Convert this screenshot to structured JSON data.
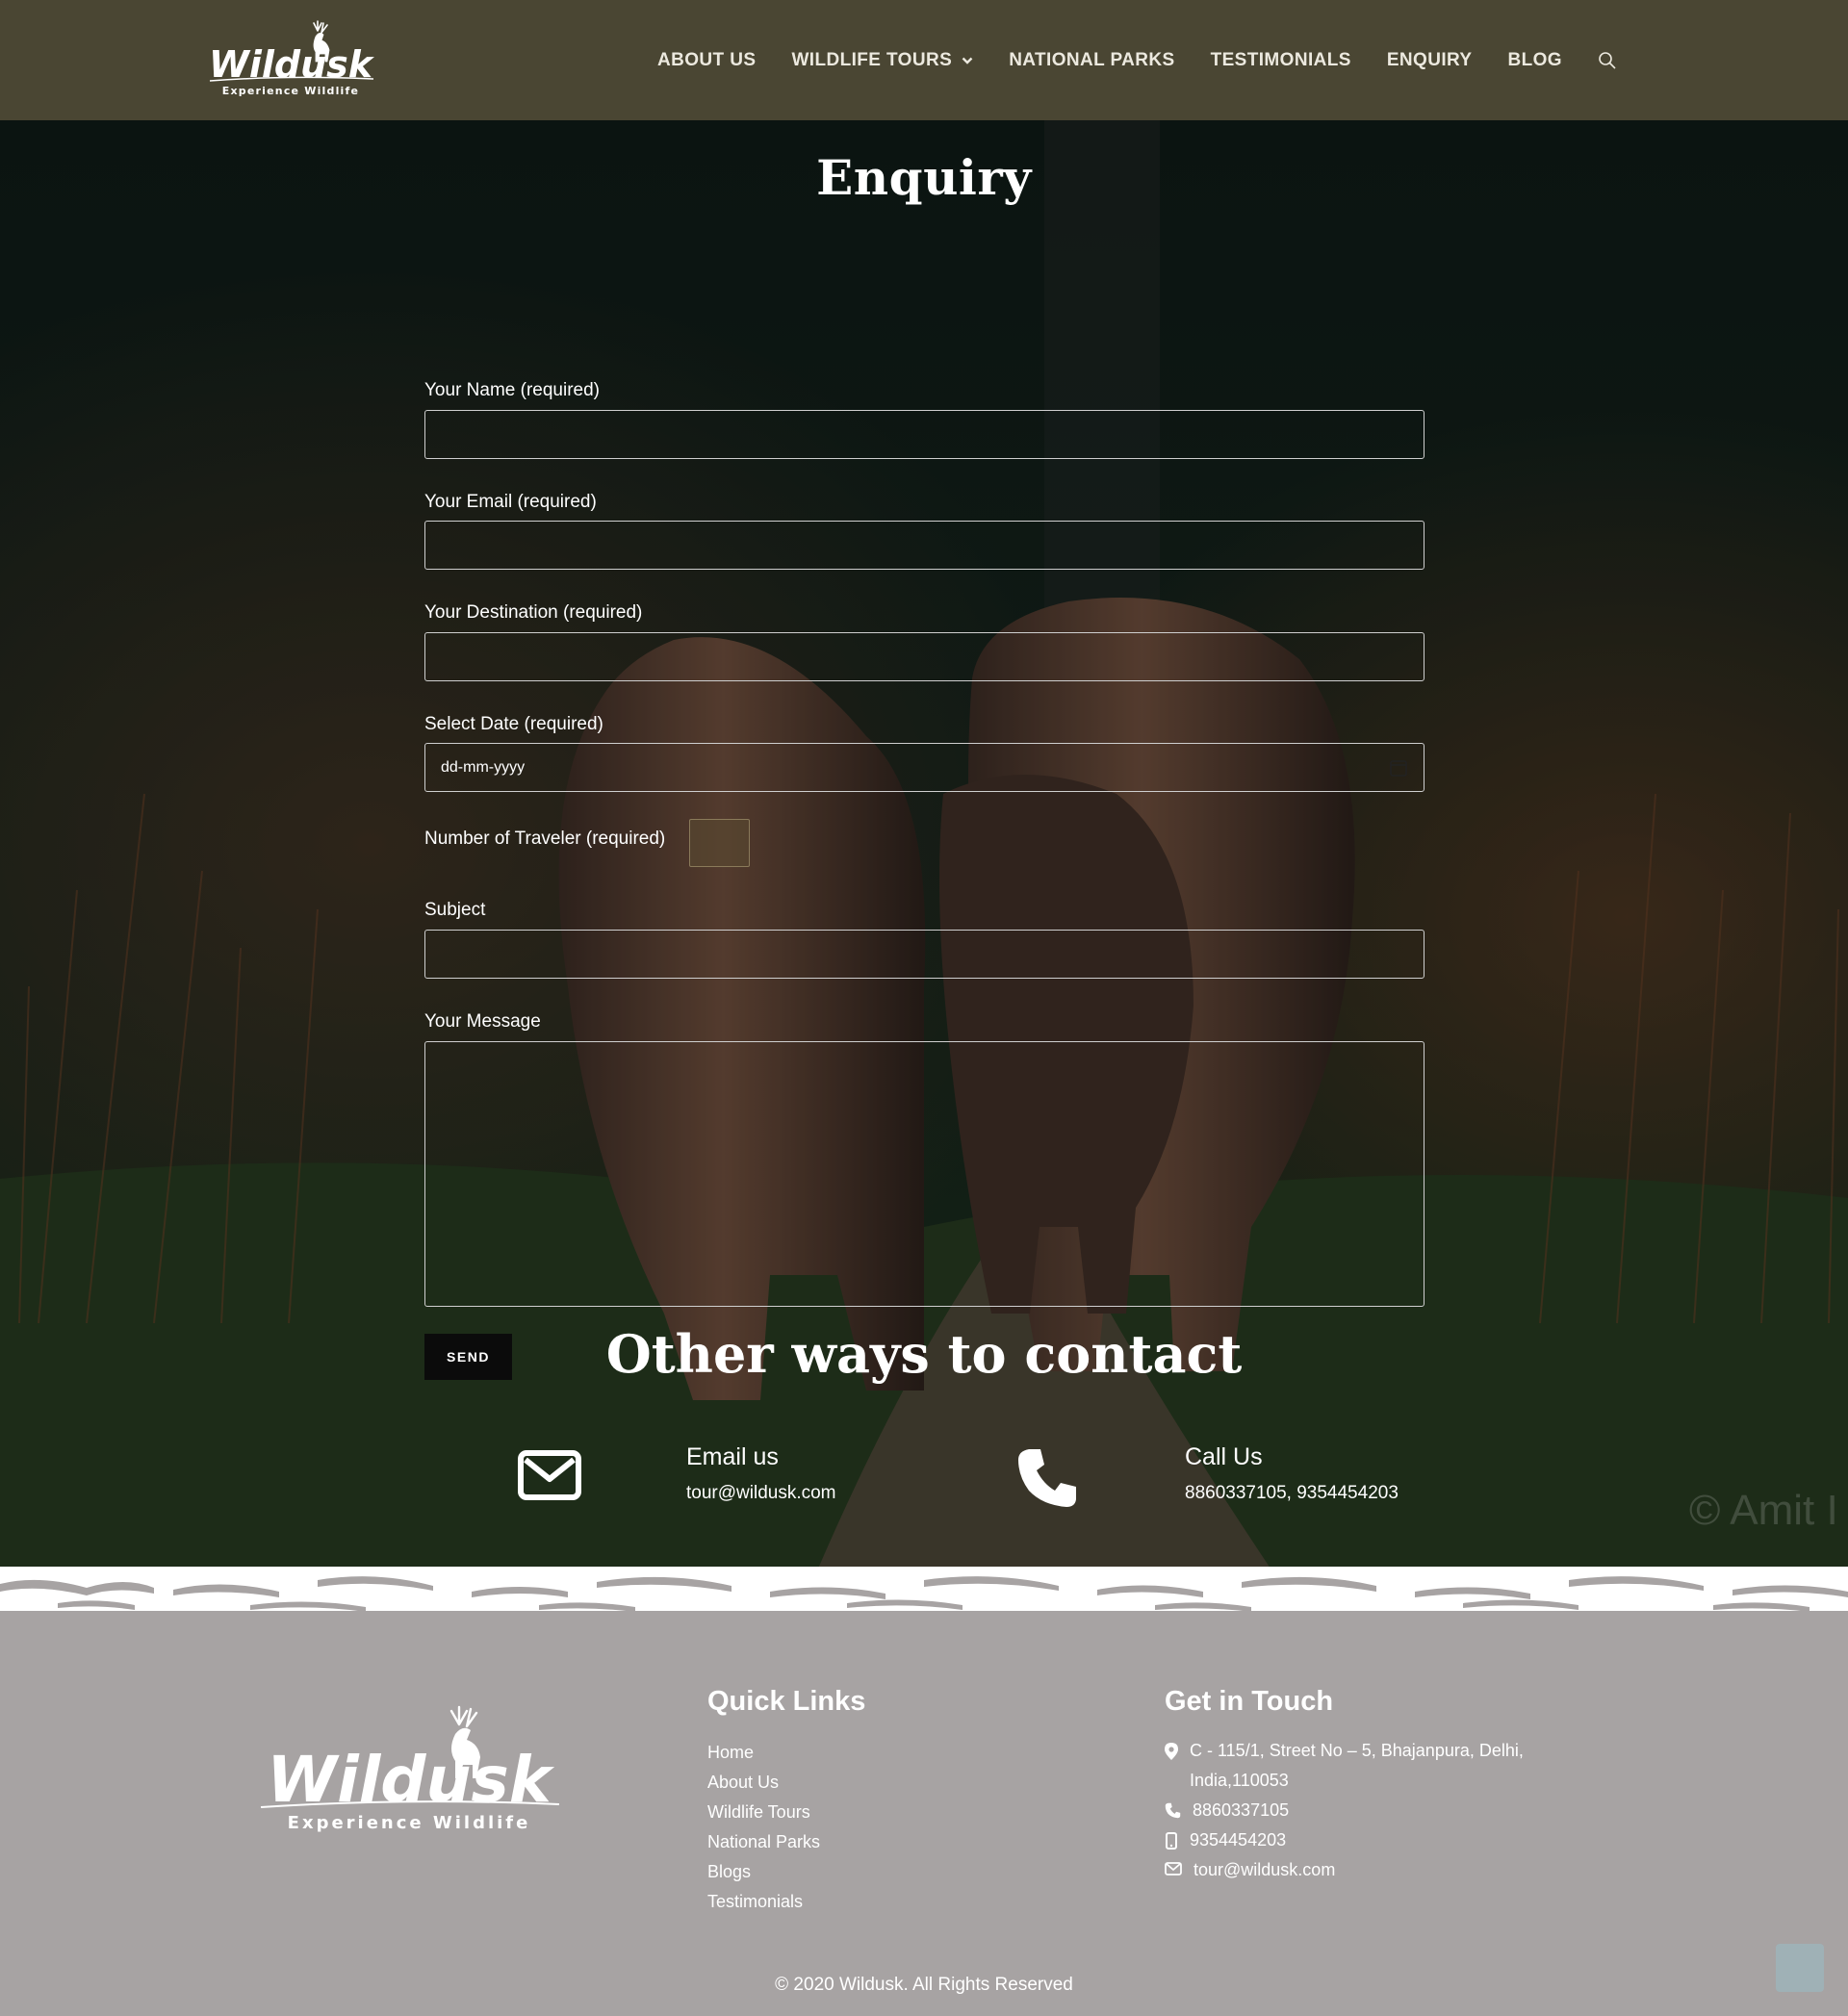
{
  "header": {
    "logo_text": "Wildusk",
    "logo_tagline": "Experience Wildlife",
    "nav": [
      {
        "label": "ABOUT US"
      },
      {
        "label": "WILDLIFE TOURS"
      },
      {
        "label": "NATIONAL PARKS"
      },
      {
        "label": "TESTIMONIALS"
      },
      {
        "label": "ENQUIRY"
      },
      {
        "label": "BLOG"
      }
    ]
  },
  "page_title": "Enquiry",
  "form": {
    "name_label": "Your Name (required)",
    "email_label": "Your Email (required)",
    "destination_label": "Your Destination (required)",
    "date_label": "Select Date (required)",
    "date_placeholder": "dd-mm-yyyy",
    "traveler_label": "Number of Traveler (required)",
    "subject_label": "Subject",
    "message_label": "Your Message",
    "send_label": "SEND"
  },
  "contact": {
    "title": "Other ways to contact",
    "email_heading": "Email us",
    "email_value": "tour@wildusk.com",
    "call_heading": "Call Us",
    "call_value": "8860337105, 9354454203",
    "watermark": "© Amit I"
  },
  "footer": {
    "quick_links_title": "Quick Links",
    "quick_links": [
      "Home",
      "About Us",
      "Wildlife Tours",
      "National Parks",
      "Blogs",
      "Testimonials"
    ],
    "get_in_touch_title": "Get in Touch",
    "address_line1": "C - 115/1, Street No – 5, Bhajanpura, Delhi,",
    "address_line2": "India,110053",
    "phone1": "8860337105",
    "phone2": "9354454203",
    "email": "tour@wildusk.com",
    "copyright": "© 2020 Wildusk. All Rights Reserved"
  },
  "colors": {
    "header_bg": "#4a4633",
    "footer_bg": "#a7a3a3",
    "send_button_bg": "#0b0b0b"
  },
  "icons": [
    "search-icon",
    "chevron-down-icon",
    "calendar-icon",
    "envelope-icon",
    "phone-icon",
    "map-pin-icon",
    "mobile-icon",
    "mail-icon"
  ]
}
